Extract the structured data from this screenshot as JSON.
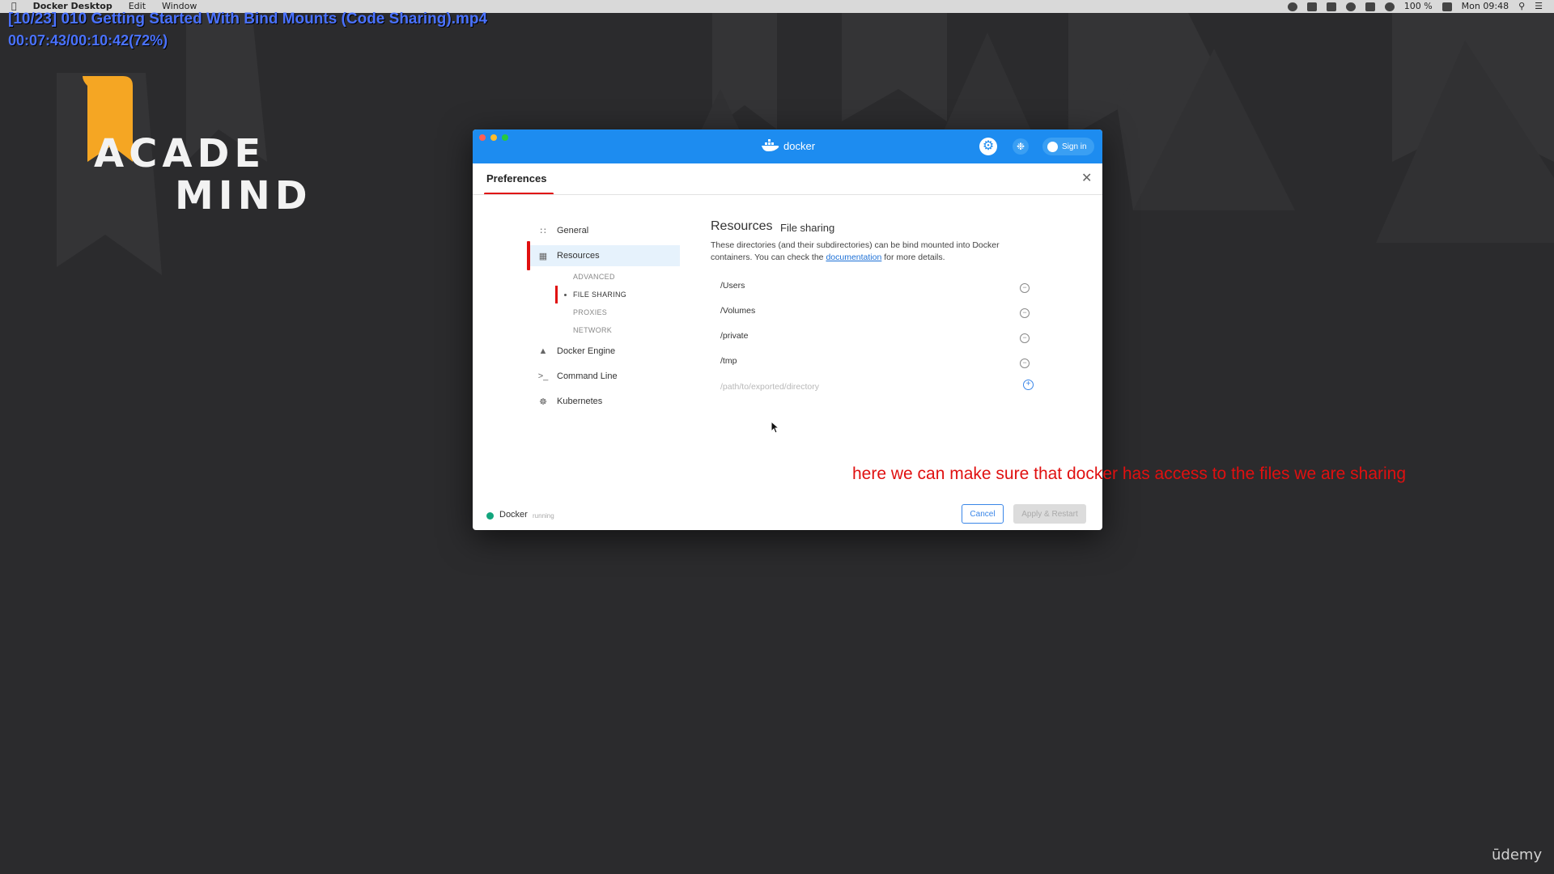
{
  "menubar": {
    "app_name": "Docker Desktop",
    "menus": [
      "Edit",
      "Window"
    ],
    "battery": "100 %",
    "clock": "Mon 09:48"
  },
  "overlay": {
    "title": "[10/23] 010 Getting Started With Bind Mounts (Code Sharing).mp4",
    "time": "00:07:43/00:10:42(72%)"
  },
  "logo": {
    "line1": "ACADE",
    "line2": "MIND"
  },
  "window": {
    "brand": "docker",
    "sign_in": "Sign in",
    "title": "Preferences",
    "sidebar": [
      {
        "label": "General",
        "icon": "sliders-icon"
      },
      {
        "label": "Resources",
        "icon": "cpu-icon"
      },
      {
        "label": "Docker Engine",
        "icon": "whale-icon"
      },
      {
        "label": "Command Line",
        "icon": "terminal-icon"
      },
      {
        "label": "Kubernetes",
        "icon": "helm-icon"
      }
    ],
    "sub_items": [
      "ADVANCED",
      "FILE SHARING",
      "PROXIES",
      "NETWORK"
    ],
    "content": {
      "heading": "Resources",
      "subheading": "File sharing",
      "desc_prefix": "These directories (and their subdirectories) can be bind mounted into Docker containers. You can check the",
      "desc_link": "documentation",
      "desc_suffix": "for more details.",
      "paths": [
        "/Users",
        "/Volumes",
        "/private",
        "/tmp"
      ],
      "path_placeholder": "/path/to/exported/directory"
    },
    "status": {
      "name": "Docker",
      "state": "running",
      "color": "#12a57d"
    },
    "buttons": {
      "cancel": "Cancel",
      "apply": "Apply & Restart"
    }
  },
  "annotation": "here we can make sure that docker has access to the files we are sharing",
  "watermark": "ūdemy",
  "colors": {
    "accent": "#1d8cf0",
    "annotation": "#e01010",
    "overlay_text": "#4a72ff"
  }
}
